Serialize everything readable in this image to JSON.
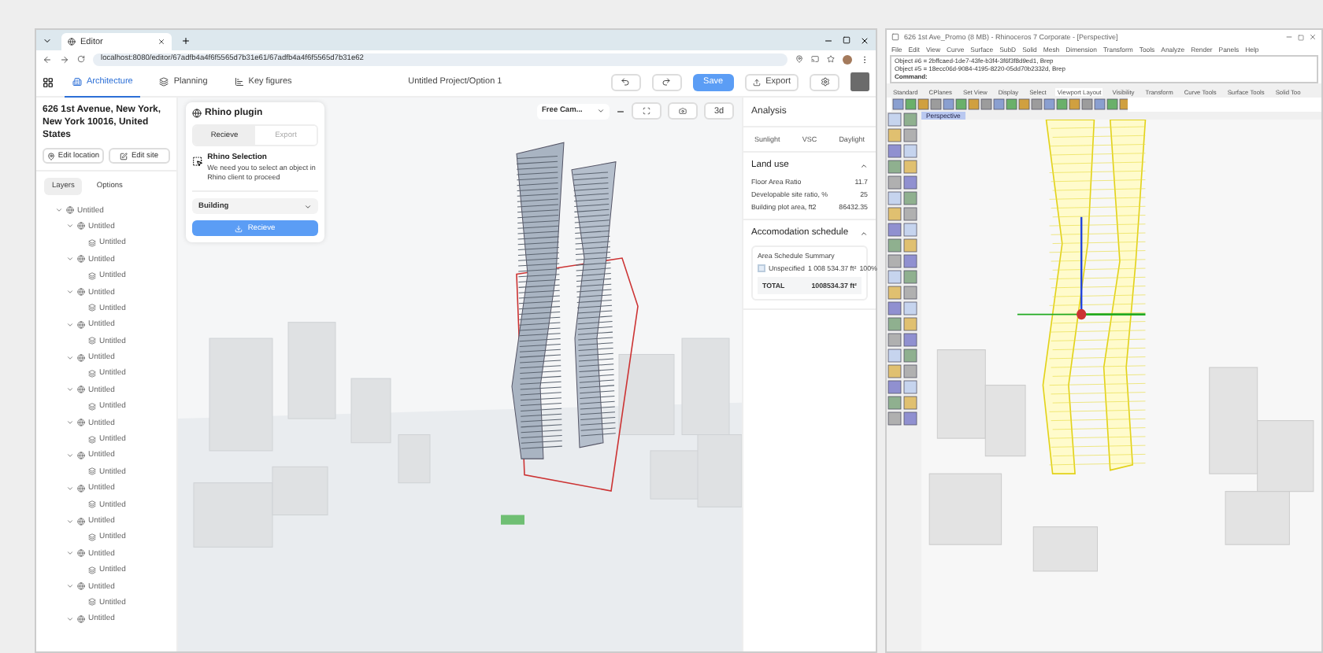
{
  "browser": {
    "tab_title": "Editor",
    "url": "localhost:8080/editor/67adfb4a4f6f5565d7b31e61/67adfb4a4f6f5565d7b31e62"
  },
  "app": {
    "nav_tabs": [
      {
        "label": "Architecture",
        "selected": true
      },
      {
        "label": "Planning",
        "selected": false
      },
      {
        "label": "Key figures",
        "selected": false
      }
    ],
    "project_title": "Untitled Project/Option 1",
    "save": "Save",
    "export": "Export"
  },
  "site": {
    "address": "626 1st Avenue, New York, New York 10016, United States",
    "edit_location": "Edit location",
    "edit_site": "Edit site"
  },
  "layer_tabs": [
    {
      "label": "Layers",
      "selected": true
    },
    {
      "label": "Options",
      "selected": false
    }
  ],
  "layers": [
    {
      "label": "Untitled",
      "kind": "group",
      "expanded": true,
      "children": [
        {
          "label": "Untitled",
          "kind": "group",
          "expanded": true,
          "children": [
            {
              "label": "Untitled",
              "kind": "layer"
            }
          ]
        },
        {
          "label": "Untitled",
          "kind": "group",
          "expanded": true,
          "children": [
            {
              "label": "Untitled",
              "kind": "layer"
            }
          ]
        },
        {
          "label": "Untitled",
          "kind": "group",
          "expanded": true,
          "children": [
            {
              "label": "Untitled",
              "kind": "layer"
            }
          ]
        },
        {
          "label": "Untitled",
          "kind": "group",
          "expanded": true,
          "children": [
            {
              "label": "Untitled",
              "kind": "layer"
            }
          ]
        },
        {
          "label": "Untitled",
          "kind": "group",
          "expanded": true,
          "children": [
            {
              "label": "Untitled",
              "kind": "layer"
            }
          ]
        },
        {
          "label": "Untitled",
          "kind": "group",
          "expanded": true,
          "children": [
            {
              "label": "Untitled",
              "kind": "layer"
            }
          ]
        },
        {
          "label": "Untitled",
          "kind": "group",
          "expanded": true,
          "children": [
            {
              "label": "Untitled",
              "kind": "layer"
            }
          ]
        },
        {
          "label": "Untitled",
          "kind": "group",
          "expanded": true,
          "children": [
            {
              "label": "Untitled",
              "kind": "layer"
            }
          ]
        },
        {
          "label": "Untitled",
          "kind": "group",
          "expanded": true,
          "children": [
            {
              "label": "Untitled",
              "kind": "layer"
            }
          ]
        },
        {
          "label": "Untitled",
          "kind": "group",
          "expanded": true,
          "children": [
            {
              "label": "Untitled",
              "kind": "layer"
            }
          ]
        },
        {
          "label": "Untitled",
          "kind": "group",
          "expanded": true,
          "children": [
            {
              "label": "Untitled",
              "kind": "layer"
            }
          ]
        },
        {
          "label": "Untitled",
          "kind": "group",
          "expanded": true,
          "children": [
            {
              "label": "Untitled",
              "kind": "layer"
            }
          ]
        },
        {
          "label": "Untitled",
          "kind": "group",
          "expanded": true
        }
      ]
    }
  ],
  "plugin": {
    "title": "Rhino plugin",
    "tabs": [
      {
        "label": "Recieve",
        "selected": true
      },
      {
        "label": "Export",
        "selected": false
      }
    ],
    "selection_title": "Rhino Selection",
    "selection_text": "We need you to select an object in Rhino client to proceed",
    "dropdown": "Building",
    "action": "Recieve"
  },
  "viewport": {
    "camera": "Free Cam...",
    "mode_button": "3d"
  },
  "analysis": {
    "title": "Analysis",
    "tabs": [
      "Sunlight",
      "VSC",
      "Daylight"
    ],
    "land_use": {
      "title": "Land use",
      "expanded": true,
      "rows": [
        {
          "label": "Floor Area Ratio",
          "value": "11.7"
        },
        {
          "label": "Developable site ratio, %",
          "value": "25"
        },
        {
          "label": "Building plot area, ft2",
          "value": "86432.35"
        }
      ]
    },
    "schedule": {
      "title": "Accomodation schedule",
      "expanded": true,
      "summary_title": "Area Schedule Summary",
      "rows": [
        {
          "label": "Unspecified",
          "area": "1 008 534.37 ft²",
          "share": "100%",
          "color": "#e3ecf7"
        }
      ],
      "total_label": "TOTAL",
      "total_value": "1008534.37 ft²"
    }
  },
  "rhino": {
    "title": "626 1st Ave_Promo (8 MB) - Rhinoceros 7 Corporate - [Perspective]",
    "menu": [
      "File",
      "Edit",
      "View",
      "Curve",
      "Surface",
      "SubD",
      "Solid",
      "Mesh",
      "Dimension",
      "Transform",
      "Tools",
      "Analyze",
      "Render",
      "Panels",
      "Help"
    ],
    "history": [
      "Object #6 = 2bffcaed-1de7-43fe-b3f4-3f6f3f8d9ed1, Brep",
      "Object #5 = 18ecc06d-9084-4195-8220-05dd70b2332d, Brep"
    ],
    "command_label": "Command:",
    "toolbar_tabs": [
      {
        "label": "Standard",
        "selected": false
      },
      {
        "label": "CPlanes",
        "selected": false
      },
      {
        "label": "Set View",
        "selected": false
      },
      {
        "label": "Display",
        "selected": false
      },
      {
        "label": "Select",
        "selected": false
      },
      {
        "label": "Viewport Layout",
        "selected": true
      },
      {
        "label": "Visibility",
        "selected": false
      },
      {
        "label": "Transform",
        "selected": false
      },
      {
        "label": "Curve Tools",
        "selected": false
      },
      {
        "label": "Surface Tools",
        "selected": false
      },
      {
        "label": "Solid Too",
        "selected": false
      }
    ],
    "viewport_label": "Perspective"
  }
}
